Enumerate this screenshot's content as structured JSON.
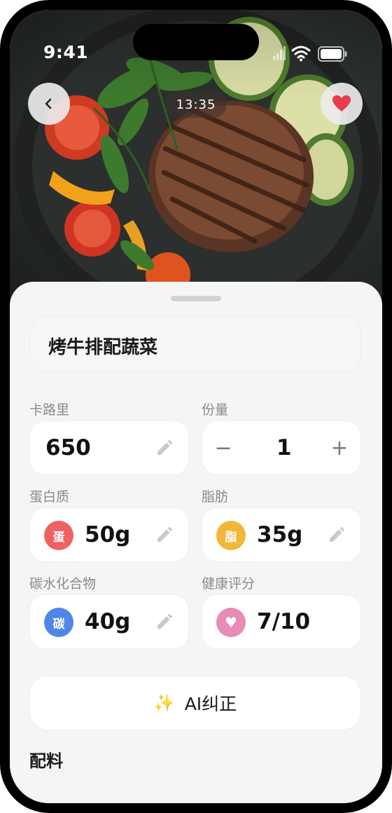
{
  "status_bar": {
    "time": "9:41"
  },
  "photo": {
    "timer": "13:35"
  },
  "recipe": {
    "name": "烤牛排配蔬菜"
  },
  "fields": {
    "calories": {
      "label": "卡路里",
      "value": "650"
    },
    "servings": {
      "label": "份量",
      "value": "1",
      "minus": "−",
      "plus": "+"
    },
    "protein": {
      "label": "蛋白质",
      "badge": "蛋",
      "value": "50g",
      "color": "#ee6262"
    },
    "fat": {
      "label": "脂肪",
      "badge": "脂",
      "value": "35g",
      "color": "#f2b739"
    },
    "carbs": {
      "label": "碳水化合物",
      "badge": "碳",
      "value": "40g",
      "color": "#4f87e8"
    },
    "health": {
      "label": "健康评分",
      "badge": "♥",
      "value": "7/10",
      "color": "#e88bb5"
    }
  },
  "actions": {
    "ai_correct": "AI纠正",
    "ai_icon": "sparkles-icon"
  },
  "sections": {
    "ingredients": "配料"
  },
  "icons": [
    "back-chevron-icon",
    "heart-icon",
    "pencil-icon",
    "signal-icon",
    "wifi-icon",
    "battery-icon"
  ]
}
